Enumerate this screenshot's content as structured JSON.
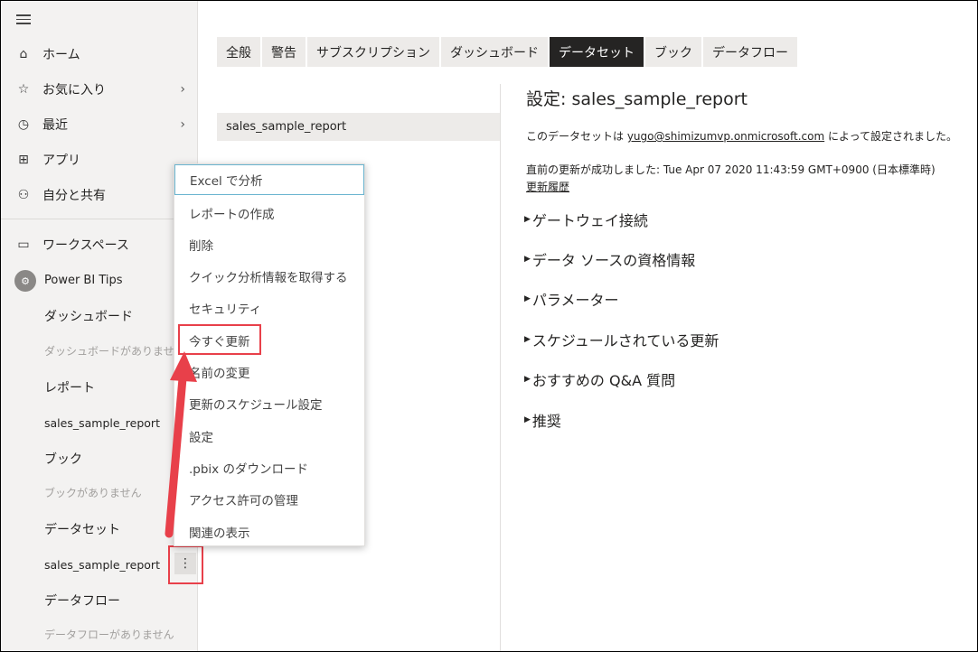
{
  "nav": {
    "items": [
      {
        "label": "ホーム",
        "icon": "home-icon",
        "glyph": "⌂"
      },
      {
        "label": "お気に入り",
        "icon": "star-icon",
        "glyph": "☆",
        "chevron": "›"
      },
      {
        "label": "最近",
        "icon": "clock-icon",
        "glyph": "◷",
        "chevron": "›"
      },
      {
        "label": "アプリ",
        "icon": "apps-icon",
        "glyph": "⊞"
      },
      {
        "label": "自分と共有",
        "icon": "shared-icon",
        "glyph": "⚇"
      }
    ],
    "workspaces_label": "ワークスペース",
    "workspace_name": "Power BI Tips",
    "dashboards_label": "ダッシュボード",
    "no_dashboards": "ダッシュボードがありませ",
    "reports_label": "レポート",
    "report_item": "sales_sample_report",
    "books_label": "ブック",
    "no_books": "ブックがありません",
    "datasets_label": "データセット",
    "dataset_item": "sales_sample_report",
    "more_glyph": "⋮",
    "dataflows_label": "データフロー",
    "no_dataflows": "データフローがありません"
  },
  "tabs": [
    "全般",
    "警告",
    "サブスクリプション",
    "ダッシュボード",
    "データセット",
    "ブック",
    "データフロー"
  ],
  "active_tab": "データセット",
  "dataset_list_item": "sales_sample_report",
  "settings": {
    "title": "設定: sales_sample_report",
    "configured_prefix": "このデータセットは ",
    "configured_user": "yugo@shimizumvp.onmicrosoft.com",
    "configured_suffix": " によって設定されました。",
    "last_refresh": "直前の更新が成功しました: Tue Apr 07 2020 11:43:59 GMT+0900 (日本標準時)",
    "history_link": "更新履歴",
    "sections": [
      "ゲートウェイ接続",
      "データ ソースの資格情報",
      "パラメーター",
      "スケジュールされている更新",
      "おすすめの Q&A 質問",
      "推奨"
    ]
  },
  "context_menu": [
    "Excel で分析",
    "レポートの作成",
    "削除",
    "クイック分析情報を取得する",
    "セキュリティ",
    "今すぐ更新",
    "名前の変更",
    "更新のスケジュール設定",
    "設定",
    ".pbix のダウンロード",
    "アクセス許可の管理",
    "関連の表示"
  ],
  "colors": {
    "highlight": "#e8404a",
    "active_tab": "#252423",
    "focus_border": "#69b4cf"
  }
}
